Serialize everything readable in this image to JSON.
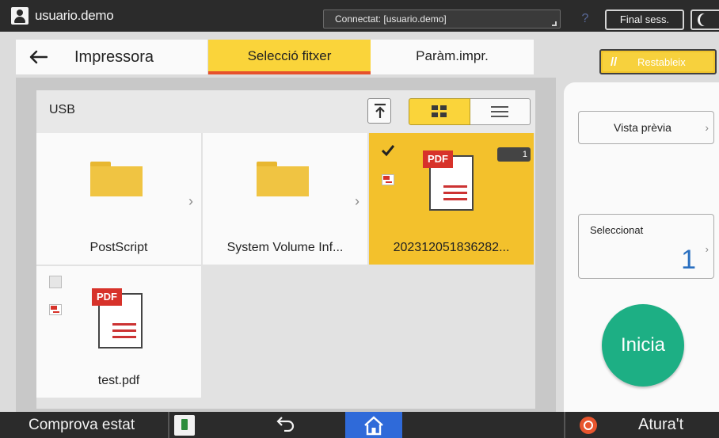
{
  "topbar": {
    "user_name": "usuario.demo",
    "connection_text": "Connectat: [usuario.demo]",
    "help_label": "?",
    "logout_label": "Final sess."
  },
  "header": {
    "app_title": "Impressora",
    "tabs": [
      {
        "label": "Selecció fitxer",
        "active": true
      },
      {
        "label": "Paràm.impr.",
        "active": false
      }
    ],
    "reset_label": "Restableix"
  },
  "browser": {
    "location": "USB",
    "view_mode": "grid",
    "items": [
      {
        "type": "folder",
        "label": "PostScript"
      },
      {
        "type": "folder",
        "label": "System Volume Inf..."
      },
      {
        "type": "pdf",
        "label": "202312051836282...",
        "selected": true,
        "copies": "1"
      },
      {
        "type": "pdf",
        "label": "test.pdf",
        "selected": false
      }
    ]
  },
  "right_panel": {
    "preview_label": "Vista prèvia",
    "selected_label": "Seleccionat",
    "selected_count": "1",
    "start_label": "Inicia"
  },
  "bottombar": {
    "status_label": "Comprova estat",
    "stop_label": "Atura't"
  },
  "colors": {
    "accent_yellow": "#fad43a",
    "tab_underline": "#e6512c",
    "start_green": "#1daf84",
    "home_blue": "#2f6ad9",
    "stop_orange": "#e8552e",
    "count_blue": "#2a6fc0"
  }
}
